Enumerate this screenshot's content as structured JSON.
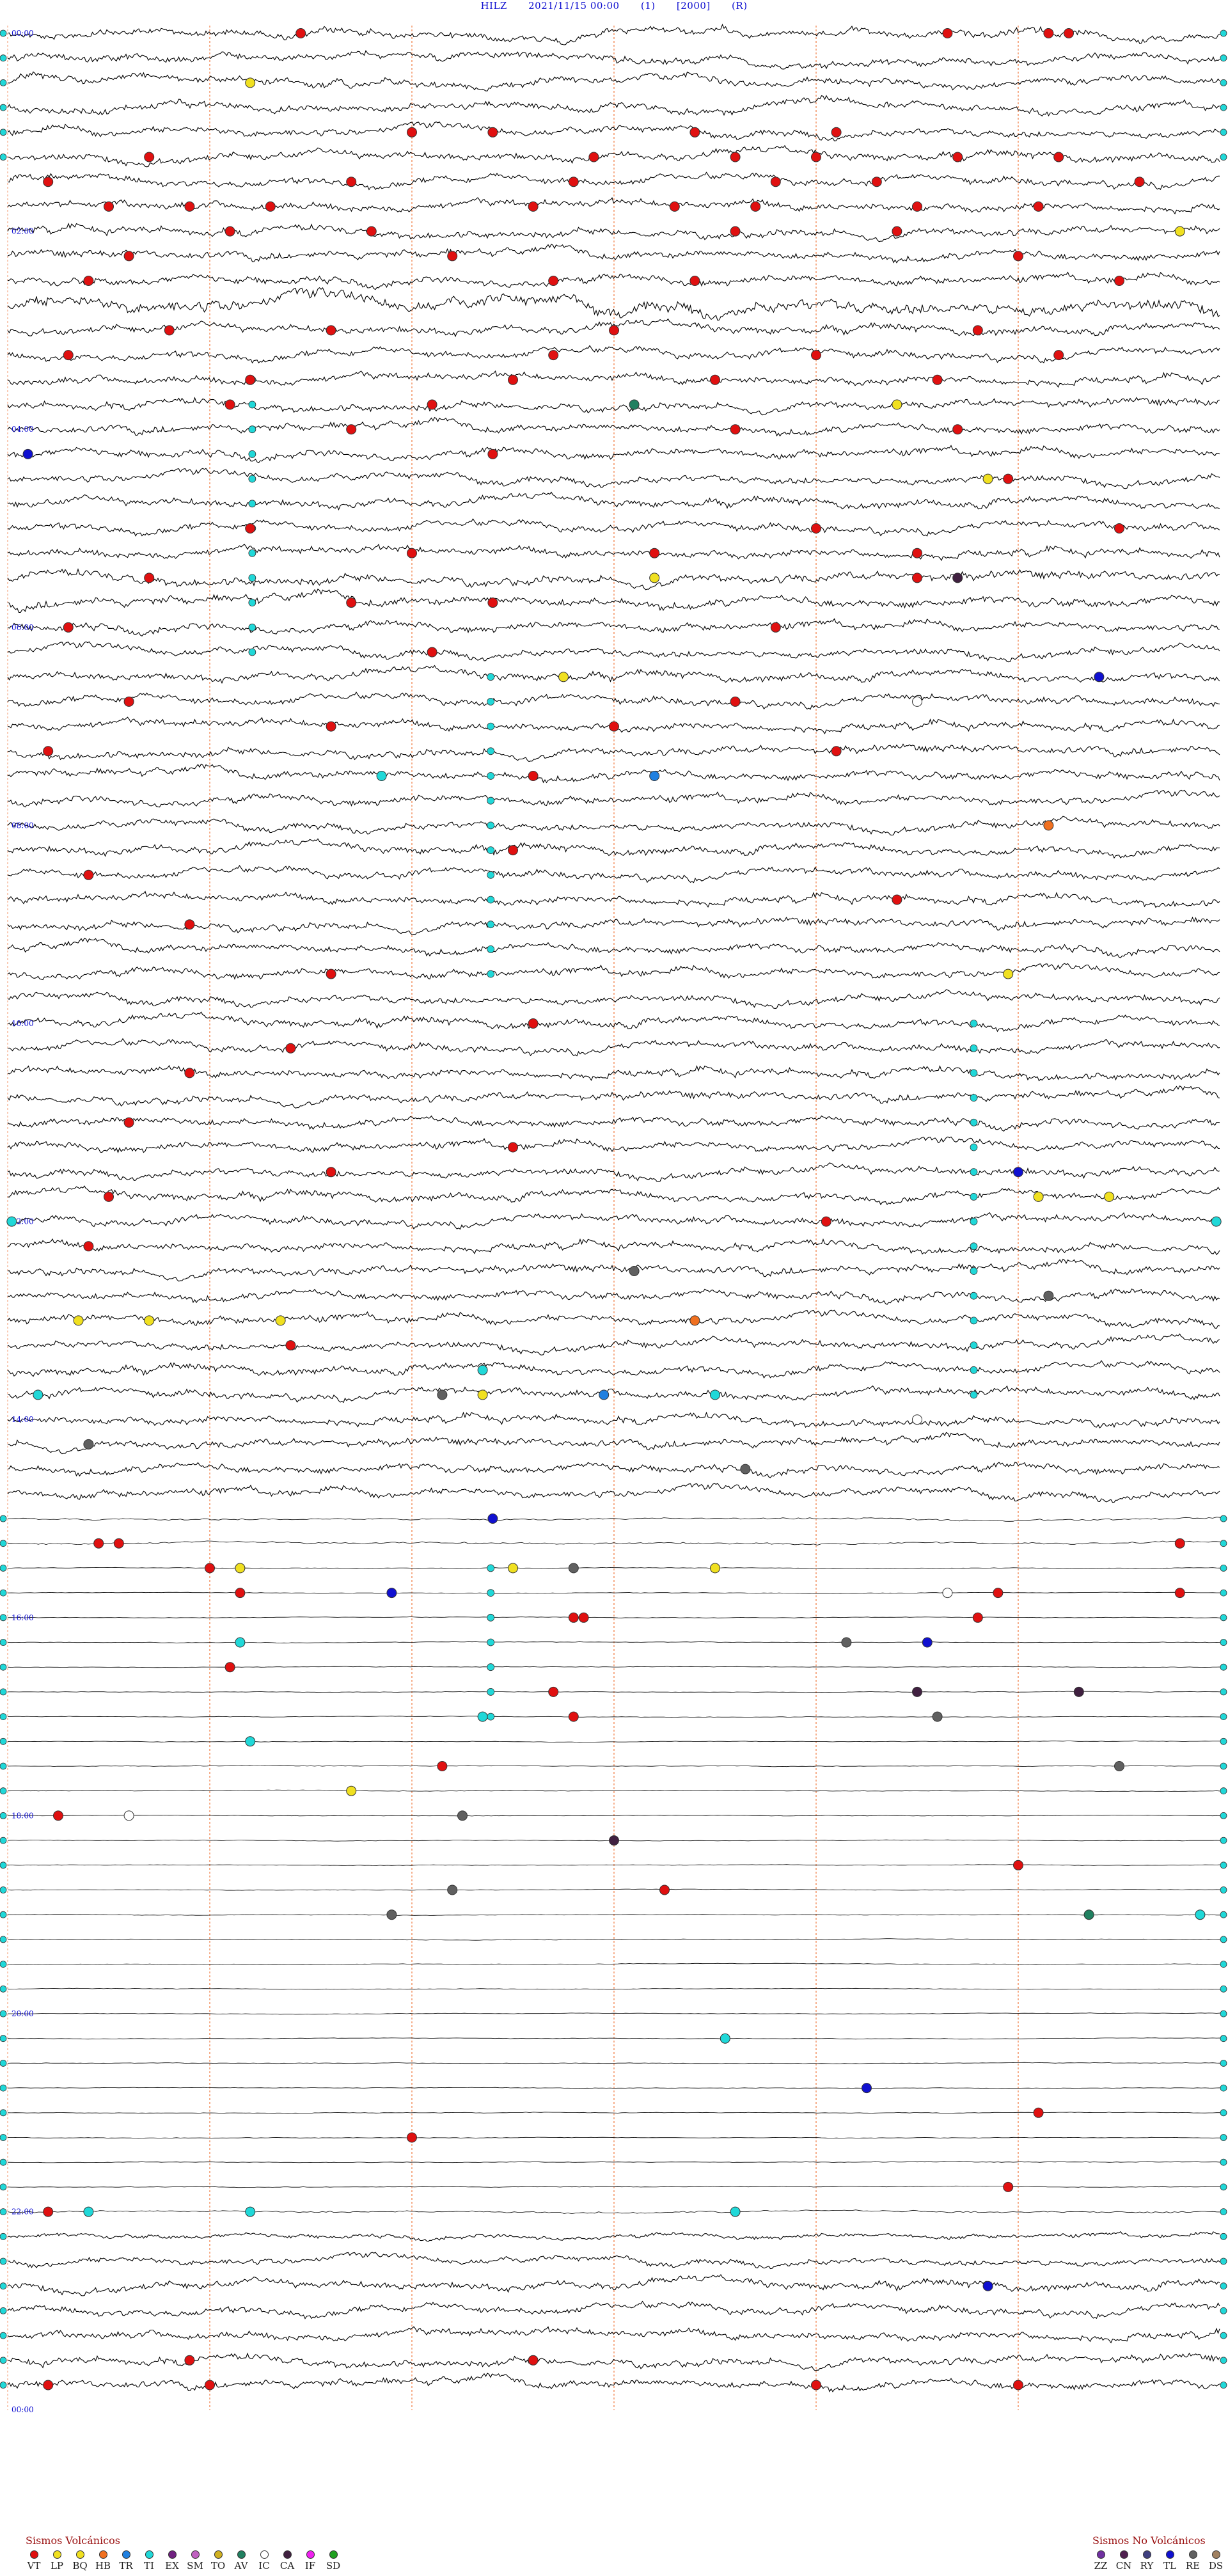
{
  "header": {
    "station": "HILZ",
    "datetime": "2021/11/15 00:00",
    "field1": "(1)",
    "field2": "[2000]",
    "field3": "(R)"
  },
  "chart_data": {
    "type": "helicorder",
    "rows_per_hour": 4,
    "total_rows": 96,
    "y_time_labels": [
      "00:00",
      "02:00",
      "04:00",
      "06:00",
      "08:00",
      "10:00",
      "12:00",
      "14:00",
      "16:00",
      "18:00",
      "20:00",
      "22:00",
      "00:00"
    ],
    "trace_color": "#000000",
    "label_color": "#1010d0",
    "minute_marker_color": "#ee6a2a",
    "row_amplitude": [
      7,
      7,
      7,
      7,
      7,
      7,
      7,
      7,
      7,
      7,
      7,
      12,
      7,
      7,
      7,
      7,
      7,
      7,
      7,
      7,
      7,
      7,
      8,
      8,
      7,
      7,
      7,
      7,
      7,
      7,
      7,
      7,
      7,
      7,
      7,
      7,
      7,
      7,
      7,
      7,
      7,
      7,
      7,
      7,
      7,
      7,
      7,
      7,
      7,
      7,
      7,
      7,
      7,
      7,
      7,
      7,
      7,
      7,
      7,
      7,
      2,
      2,
      0.6,
      0.6,
      0.6,
      0.6,
      0.6,
      0.6,
      0.6,
      0.6,
      0.6,
      0.6,
      0.6,
      0.6,
      0.6,
      0.6,
      0.6,
      0.6,
      0.6,
      0.6,
      0.6,
      0.6,
      0.6,
      0.6,
      0.6,
      0.6,
      0.6,
      0.6,
      2,
      4,
      6,
      7,
      7,
      7,
      7,
      7
    ],
    "event_types": {
      "VT": "#e01010",
      "LP": "#f0e020",
      "BQ": "#f0e020",
      "HB": "#f07020",
      "TR": "#2080e0",
      "TI": "#20d8d8",
      "EX": "#702080",
      "SM": "#c060c0",
      "TO": "#d0b020",
      "AV": "#208060",
      "IC": "#ffffff",
      "CA": "#402040",
      "IF": "#f020f0",
      "SD": "#20a020",
      "ZZ": "#7030a0",
      "CN": "#502050",
      "RY": "#404080",
      "TL": "#1010d0",
      "RE": "#606060",
      "DS": "#a08060"
    },
    "events": [
      {
        "row": 0,
        "minute": 14.5,
        "type": "VT"
      },
      {
        "row": 0,
        "minute": 46.5,
        "type": "VT"
      },
      {
        "row": 0,
        "minute": 51.5,
        "type": "VT"
      },
      {
        "row": 0,
        "minute": 52.5,
        "type": "VT"
      },
      {
        "row": 2,
        "minute": 12.0,
        "type": "LP"
      },
      {
        "row": 4,
        "minute": 20.0,
        "type": "VT"
      },
      {
        "row": 4,
        "minute": 24.0,
        "type": "VT"
      },
      {
        "row": 4,
        "minute": 34.0,
        "type": "VT"
      },
      {
        "row": 4,
        "minute": 41.0,
        "type": "VT"
      },
      {
        "row": 5,
        "minute": 7.0,
        "type": "VT"
      },
      {
        "row": 5,
        "minute": 29.0,
        "type": "VT"
      },
      {
        "row": 5,
        "minute": 36.0,
        "type": "VT"
      },
      {
        "row": 5,
        "minute": 40.0,
        "type": "VT"
      },
      {
        "row": 5,
        "minute": 47.0,
        "type": "VT"
      },
      {
        "row": 5,
        "minute": 52.0,
        "type": "VT"
      },
      {
        "row": 6,
        "minute": 2.0,
        "type": "VT"
      },
      {
        "row": 6,
        "minute": 17.0,
        "type": "VT"
      },
      {
        "row": 6,
        "minute": 28.0,
        "type": "VT"
      },
      {
        "row": 6,
        "minute": 38.0,
        "type": "VT"
      },
      {
        "row": 6,
        "minute": 43.0,
        "type": "VT"
      },
      {
        "row": 6,
        "minute": 56.0,
        "type": "VT"
      },
      {
        "row": 7,
        "minute": 5.0,
        "type": "VT"
      },
      {
        "row": 7,
        "minute": 9.0,
        "type": "VT"
      },
      {
        "row": 7,
        "minute": 13.0,
        "type": "VT"
      },
      {
        "row": 7,
        "minute": 26.0,
        "type": "VT"
      },
      {
        "row": 7,
        "minute": 33.0,
        "type": "VT"
      },
      {
        "row": 7,
        "minute": 37.0,
        "type": "VT"
      },
      {
        "row": 7,
        "minute": 45.0,
        "type": "VT"
      },
      {
        "row": 7,
        "minute": 51.0,
        "type": "VT"
      },
      {
        "row": 8,
        "minute": 58.0,
        "type": "LP"
      },
      {
        "row": 8,
        "minute": 11.0,
        "type": "VT"
      },
      {
        "row": 8,
        "minute": 18.0,
        "type": "VT"
      },
      {
        "row": 8,
        "minute": 36.0,
        "type": "VT"
      },
      {
        "row": 8,
        "minute": 44.0,
        "type": "VT"
      },
      {
        "row": 9,
        "minute": 6.0,
        "type": "VT"
      },
      {
        "row": 9,
        "minute": 22.0,
        "type": "VT"
      },
      {
        "row": 9,
        "minute": 50.0,
        "type": "VT"
      },
      {
        "row": 10,
        "minute": 4.0,
        "type": "VT"
      },
      {
        "row": 10,
        "minute": 27.0,
        "type": "VT"
      },
      {
        "row": 10,
        "minute": 34.0,
        "type": "VT"
      },
      {
        "row": 10,
        "minute": 55.0,
        "type": "VT"
      },
      {
        "row": 12,
        "minute": 8.0,
        "type": "VT"
      },
      {
        "row": 12,
        "minute": 16.0,
        "type": "VT"
      },
      {
        "row": 12,
        "minute": 30.0,
        "type": "VT"
      },
      {
        "row": 12,
        "minute": 48.0,
        "type": "VT"
      },
      {
        "row": 13,
        "minute": 3.0,
        "type": "VT"
      },
      {
        "row": 13,
        "minute": 27.0,
        "type": "VT"
      },
      {
        "row": 13,
        "minute": 40.0,
        "type": "VT"
      },
      {
        "row": 13,
        "minute": 52.0,
        "type": "VT"
      },
      {
        "row": 14,
        "minute": 12.0,
        "type": "VT"
      },
      {
        "row": 14,
        "minute": 25.0,
        "type": "VT"
      },
      {
        "row": 14,
        "minute": 35.0,
        "type": "VT"
      },
      {
        "row": 14,
        "minute": 46.0,
        "type": "VT"
      },
      {
        "row": 15,
        "minute": 31.0,
        "type": "AV"
      },
      {
        "row": 15,
        "minute": 44.0,
        "type": "LP"
      },
      {
        "row": 15,
        "minute": 11.0,
        "type": "VT"
      },
      {
        "row": 15,
        "minute": 21.0,
        "type": "VT"
      },
      {
        "row": 16,
        "minute": 17.0,
        "type": "VT"
      },
      {
        "row": 16,
        "minute": 36.0,
        "type": "VT"
      },
      {
        "row": 16,
        "minute": 47.0,
        "type": "VT"
      },
      {
        "row": 17,
        "minute": 1.0,
        "type": "TL"
      },
      {
        "row": 17,
        "minute": 24.0,
        "type": "VT"
      },
      {
        "row": 18,
        "minute": 48.5,
        "type": "LP"
      },
      {
        "row": 18,
        "minute": 49.5,
        "type": "VT"
      },
      {
        "row": 20,
        "minute": 12.0,
        "type": "VT"
      },
      {
        "row": 20,
        "minute": 40.0,
        "type": "VT"
      },
      {
        "row": 20,
        "minute": 55.0,
        "type": "VT"
      },
      {
        "row": 21,
        "minute": 20.0,
        "type": "VT"
      },
      {
        "row": 21,
        "minute": 32.0,
        "type": "VT"
      },
      {
        "row": 21,
        "minute": 45.0,
        "type": "VT"
      },
      {
        "row": 22,
        "minute": 45.0,
        "type": "VT"
      },
      {
        "row": 22,
        "minute": 47.0,
        "type": "CA"
      },
      {
        "row": 22,
        "minute": 32.0,
        "type": "LP"
      },
      {
        "row": 22,
        "minute": 7.0,
        "type": "VT"
      },
      {
        "row": 23,
        "minute": 17.0,
        "type": "VT"
      },
      {
        "row": 23,
        "minute": 24.0,
        "type": "VT"
      },
      {
        "row": 24,
        "minute": 3.0,
        "type": "VT"
      },
      {
        "row": 24,
        "minute": 38.0,
        "type": "VT"
      },
      {
        "row": 25,
        "minute": 21.0,
        "type": "VT"
      },
      {
        "row": 26,
        "minute": 27.5,
        "type": "LP"
      },
      {
        "row": 26,
        "minute": 54.0,
        "type": "TL"
      },
      {
        "row": 27,
        "minute": 6.0,
        "type": "VT"
      },
      {
        "row": 27,
        "minute": 36.0,
        "type": "VT"
      },
      {
        "row": 27,
        "minute": 45.0,
        "type": "IC"
      },
      {
        "row": 28,
        "minute": 16.0,
        "type": "VT"
      },
      {
        "row": 28,
        "minute": 30.0,
        "type": "VT"
      },
      {
        "row": 29,
        "minute": 2.0,
        "type": "VT"
      },
      {
        "row": 29,
        "minute": 41.0,
        "type": "VT"
      },
      {
        "row": 30,
        "minute": 18.5,
        "type": "TI"
      },
      {
        "row": 30,
        "minute": 32.0,
        "type": "TR"
      },
      {
        "row": 30,
        "minute": 26.0,
        "type": "VT"
      },
      {
        "row": 32,
        "minute": 51.5,
        "type": "HB"
      },
      {
        "row": 33,
        "minute": 25.0,
        "type": "VT"
      },
      {
        "row": 34,
        "minute": 4.0,
        "type": "VT"
      },
      {
        "row": 35,
        "minute": 44.0,
        "type": "VT"
      },
      {
        "row": 36,
        "minute": 9.0,
        "type": "VT"
      },
      {
        "row": 38,
        "minute": 16.0,
        "type": "VT"
      },
      {
        "row": 38,
        "minute": 49.5,
        "type": "LP"
      },
      {
        "row": 40,
        "minute": 26.0,
        "type": "VT"
      },
      {
        "row": 41,
        "minute": 14.0,
        "type": "VT"
      },
      {
        "row": 42,
        "minute": 9.0,
        "type": "VT"
      },
      {
        "row": 44,
        "minute": 6.0,
        "type": "VT"
      },
      {
        "row": 45,
        "minute": 25.0,
        "type": "VT"
      },
      {
        "row": 46,
        "minute": 50.0,
        "type": "TL"
      },
      {
        "row": 46,
        "minute": 16.0,
        "type": "VT"
      },
      {
        "row": 47,
        "minute": 51.0,
        "type": "LP"
      },
      {
        "row": 47,
        "minute": 54.5,
        "type": "LP"
      },
      {
        "row": 47,
        "minute": 5.0,
        "type": "VT"
      },
      {
        "row": 48,
        "minute": 0.2,
        "type": "TI"
      },
      {
        "row": 48,
        "minute": 59.8,
        "type": "TI"
      },
      {
        "row": 48,
        "minute": 40.5,
        "type": "VT"
      },
      {
        "row": 49,
        "minute": 4.0,
        "type": "VT"
      },
      {
        "row": 50,
        "minute": 31.0,
        "type": "RE"
      },
      {
        "row": 51,
        "minute": 51.5,
        "type": "RE"
      },
      {
        "row": 52,
        "minute": 3.5,
        "type": "LP"
      },
      {
        "row": 52,
        "minute": 7.0,
        "type": "LP"
      },
      {
        "row": 52,
        "minute": 13.5,
        "type": "LP"
      },
      {
        "row": 52,
        "minute": 34.0,
        "type": "HB"
      },
      {
        "row": 53,
        "minute": 14.0,
        "type": "VT"
      },
      {
        "row": 54,
        "minute": 23.5,
        "type": "TI"
      },
      {
        "row": 55,
        "minute": 21.5,
        "type": "RE"
      },
      {
        "row": 55,
        "minute": 23.5,
        "type": "LP"
      },
      {
        "row": 55,
        "minute": 35.0,
        "type": "TI"
      },
      {
        "row": 55,
        "minute": 29.5,
        "type": "TR"
      },
      {
        "row": 55,
        "minute": 1.5,
        "type": "TI"
      },
      {
        "row": 56,
        "minute": 45.0,
        "type": "IC"
      },
      {
        "row": 57,
        "minute": 4.0,
        "type": "RE"
      },
      {
        "row": 58,
        "minute": 36.5,
        "type": "RE"
      },
      {
        "row": 60,
        "minute": 24.0,
        "type": "TL"
      },
      {
        "row": 61,
        "minute": 4.5,
        "type": "VT"
      },
      {
        "row": 61,
        "minute": 5.5,
        "type": "VT"
      },
      {
        "row": 61,
        "minute": 58.0,
        "type": "VT"
      },
      {
        "row": 62,
        "minute": 11.5,
        "type": "LP"
      },
      {
        "row": 62,
        "minute": 28.0,
        "type": "RE"
      },
      {
        "row": 62,
        "minute": 10.0,
        "type": "VT"
      },
      {
        "row": 62,
        "minute": 25.0,
        "type": "LP"
      },
      {
        "row": 62,
        "minute": 35.0,
        "type": "LP"
      },
      {
        "row": 63,
        "minute": 49.0,
        "type": "VT"
      },
      {
        "row": 63,
        "minute": 46.5,
        "type": "IC"
      },
      {
        "row": 63,
        "minute": 11.5,
        "type": "VT"
      },
      {
        "row": 63,
        "minute": 58.0,
        "type": "VT"
      },
      {
        "row": 63,
        "minute": 19.0,
        "type": "TL"
      },
      {
        "row": 64,
        "minute": 28.0,
        "type": "VT"
      },
      {
        "row": 64,
        "minute": 28.5,
        "type": "VT"
      },
      {
        "row": 64,
        "minute": 48.0,
        "type": "VT"
      },
      {
        "row": 65,
        "minute": 11.5,
        "type": "TI"
      },
      {
        "row": 65,
        "minute": 41.5,
        "type": "RE"
      },
      {
        "row": 65,
        "minute": 45.5,
        "type": "TL"
      },
      {
        "row": 66,
        "minute": 11.0,
        "type": "VT"
      },
      {
        "row": 67,
        "minute": 27.0,
        "type": "VT"
      },
      {
        "row": 67,
        "minute": 45.0,
        "type": "CA"
      },
      {
        "row": 67,
        "minute": 53.0,
        "type": "CA"
      },
      {
        "row": 68,
        "minute": 28.0,
        "type": "VT"
      },
      {
        "row": 68,
        "minute": 23.5,
        "type": "TI"
      },
      {
        "row": 68,
        "minute": 46.0,
        "type": "RE"
      },
      {
        "row": 69,
        "minute": 12.0,
        "type": "TI"
      },
      {
        "row": 70,
        "minute": 21.5,
        "type": "VT"
      },
      {
        "row": 70,
        "minute": 55.0,
        "type": "RE"
      },
      {
        "row": 71,
        "minute": 17.0,
        "type": "LP"
      },
      {
        "row": 72,
        "minute": 22.5,
        "type": "RE"
      },
      {
        "row": 72,
        "minute": 2.5,
        "type": "VT"
      },
      {
        "row": 72,
        "minute": 6.0,
        "type": "IC"
      },
      {
        "row": 73,
        "minute": 30.0,
        "type": "CA"
      },
      {
        "row": 74,
        "minute": 50.0,
        "type": "VT"
      },
      {
        "row": 75,
        "minute": 32.5,
        "type": "VT"
      },
      {
        "row": 75,
        "minute": 22.0,
        "type": "RE"
      },
      {
        "row": 76,
        "minute": 53.5,
        "type": "AV"
      },
      {
        "row": 76,
        "minute": 19.0,
        "type": "RE"
      },
      {
        "row": 76,
        "minute": 59.0,
        "type": "TI"
      },
      {
        "row": 81,
        "minute": 35.5,
        "type": "TI"
      },
      {
        "row": 83,
        "minute": 42.5,
        "type": "TL"
      },
      {
        "row": 84,
        "minute": 51.0,
        "type": "VT"
      },
      {
        "row": 85,
        "minute": 20.0,
        "type": "VT"
      },
      {
        "row": 87,
        "minute": 49.5,
        "type": "VT"
      },
      {
        "row": 88,
        "minute": 4.0,
        "type": "TI"
      },
      {
        "row": 88,
        "minute": 12.0,
        "type": "TI"
      },
      {
        "row": 88,
        "minute": 36.0,
        "type": "TI"
      },
      {
        "row": 88,
        "minute": 2.0,
        "type": "VT"
      },
      {
        "row": 91,
        "minute": 48.5,
        "type": "TL"
      },
      {
        "row": 94,
        "minute": 9.0,
        "type": "VT"
      },
      {
        "row": 94,
        "minute": 26.0,
        "type": "VT"
      },
      {
        "row": 95,
        "minute": 2.0,
        "type": "VT"
      },
      {
        "row": 95,
        "minute": 10.0,
        "type": "VT"
      },
      {
        "row": 95,
        "minute": 40.0,
        "type": "VT"
      },
      {
        "row": 95,
        "minute": 50.0,
        "type": "VT"
      }
    ],
    "ti_columns": [
      {
        "minute": 12.1,
        "row_from": 14,
        "row_to": 25
      },
      {
        "minute": 23.9,
        "row_from": 26,
        "row_to": 38
      },
      {
        "minute": 47.8,
        "row_from": 40,
        "row_to": 55
      },
      {
        "minute": 23.9,
        "row_from": 62,
        "row_to": 68
      }
    ]
  },
  "legend": {
    "volcanic_title": "Sismos Volcánicos",
    "volcanic": [
      {
        "code": "VT",
        "color": "#e01010"
      },
      {
        "code": "LP",
        "color": "#f0e020"
      },
      {
        "code": "BQ",
        "color": "#f0e020"
      },
      {
        "code": "HB",
        "color": "#f07020"
      },
      {
        "code": "TR",
        "color": "#2080e0"
      },
      {
        "code": "TI",
        "color": "#20d8d8"
      },
      {
        "code": "EX",
        "color": "#702080"
      },
      {
        "code": "SM",
        "color": "#c060c0"
      },
      {
        "code": "TO",
        "color": "#d0b020"
      },
      {
        "code": "AV",
        "color": "#208060"
      },
      {
        "code": "IC",
        "color": "#ffffff"
      },
      {
        "code": "CA",
        "color": "#402040"
      },
      {
        "code": "IF",
        "color": "#f020f0"
      },
      {
        "code": "SD",
        "color": "#20a020"
      }
    ],
    "nonvolcanic_title": "Sismos No Volcánicos",
    "nonvolcanic": [
      {
        "code": "ZZ",
        "color": "#7030a0"
      },
      {
        "code": "CN",
        "color": "#502050"
      },
      {
        "code": "RY",
        "color": "#404080"
      },
      {
        "code": "TL",
        "color": "#1010d0"
      },
      {
        "code": "RE",
        "color": "#606060"
      },
      {
        "code": "DS",
        "color": "#a08060"
      }
    ]
  }
}
